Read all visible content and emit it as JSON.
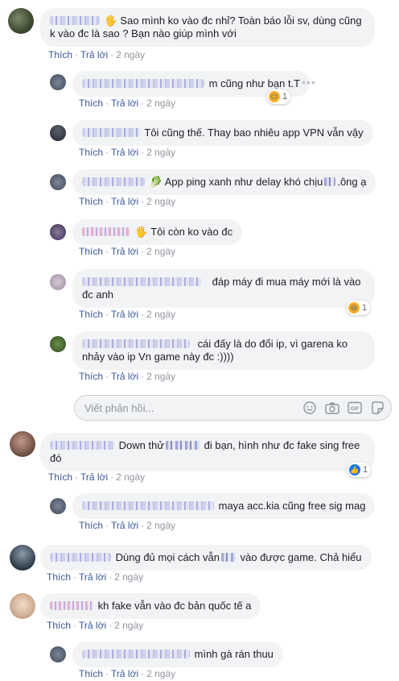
{
  "actions": {
    "like": "Thích",
    "reply": "Trả lời",
    "dot": "·"
  },
  "reply_box": {
    "placeholder": "Viết phản hồi..."
  },
  "comments": [
    {
      "text": "🖐 Sao mình ko vào đc nhỉ? Toàn báo lỗi sv, dùng cũng k vào đc là sao ? Bạn nào giúp mình với",
      "time": "2 ngày"
    },
    {
      "text": "m cũng như bạn t.T",
      "time": "2 ngày",
      "reaction_count": "1"
    },
    {
      "text": "Tôi cũng thế. Thay bao nhiêu app VPN vẫn vậy",
      "time": "2 ngày"
    },
    {
      "text": "🥬 App ping xanh như delay khó chịu",
      "suffix": ".ông ạ",
      "time": "2 ngày"
    },
    {
      "text": "🖐 Tôi còn ko vào đc",
      "time": "2 ngày"
    },
    {
      "text": "đáp máy đi mua máy mới là vào đc anh",
      "time": "2 ngày",
      "reaction_count": "1"
    },
    {
      "text": "cái đấy là do đổi ip, vì garena ko nhảy vào ip Vn game này đc :))))",
      "time": "2 ngày"
    },
    {
      "text": "Down thử",
      "text2": "đi bạn, hình như đc fake sing free đó",
      "time": "2 ngày",
      "reaction_count": "1"
    },
    {
      "text": "maya acc.kia cũng free sig mag",
      "time": "2 ngày"
    },
    {
      "text": "Dùng đủ mọi cách vẫn",
      "text2": "vào được game. Chả hiểu",
      "time": "2 ngày"
    },
    {
      "text": "kh fake vẫn vào đc bản quốc tế a",
      "time": "2 ngày"
    },
    {
      "text": "mình gà rán thuu",
      "time": "2 ngày"
    }
  ],
  "colors": {
    "link": "#385898",
    "bubble": "#f2f3f5",
    "meta": "#90949c",
    "sad_react": "#f7b125",
    "haha_react": "#f7b125",
    "like_react": "#1877f2"
  },
  "icons": [
    "more-icon",
    "sad-reaction-icon",
    "haha-reaction-icon",
    "like-reaction-icon",
    "emoji-icon",
    "camera-icon",
    "gif-icon",
    "sticker-icon"
  ]
}
